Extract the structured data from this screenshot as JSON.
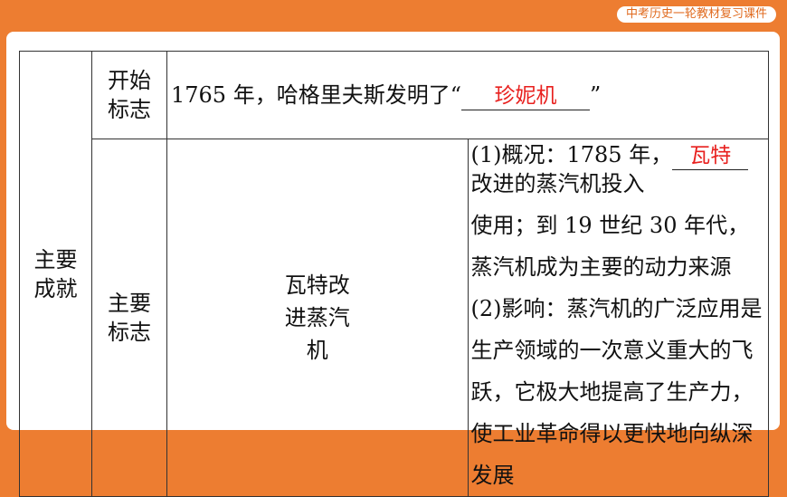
{
  "header": {
    "badge": "中考历史一轮教材复习课件"
  },
  "table": {
    "main_label": "主要成就",
    "row_start": {
      "label": "开始标志",
      "text_before": "1765 年，哈格里夫斯发明了“",
      "answer": "珍妮机",
      "text_after": "”"
    },
    "row_main": {
      "label": "主要标志",
      "category": "瓦特改进蒸汽机",
      "overview_prefix": "(1)概况：1785 年，",
      "overview_answer": "瓦特",
      "overview_suffix": "改进的蒸汽机投入",
      "usage": "使用；到 19 世纪 30 年代，蒸汽机成为主要的动力来源",
      "impact": "(2)影响：蒸汽机的广泛应用是生产领域的一次意义重大的飞跃，它极大地提高了生产力，使工业革命得以更快地向纵深发展"
    }
  },
  "colors": {
    "frame": "#ED7D31",
    "answer": "#E8201E"
  }
}
